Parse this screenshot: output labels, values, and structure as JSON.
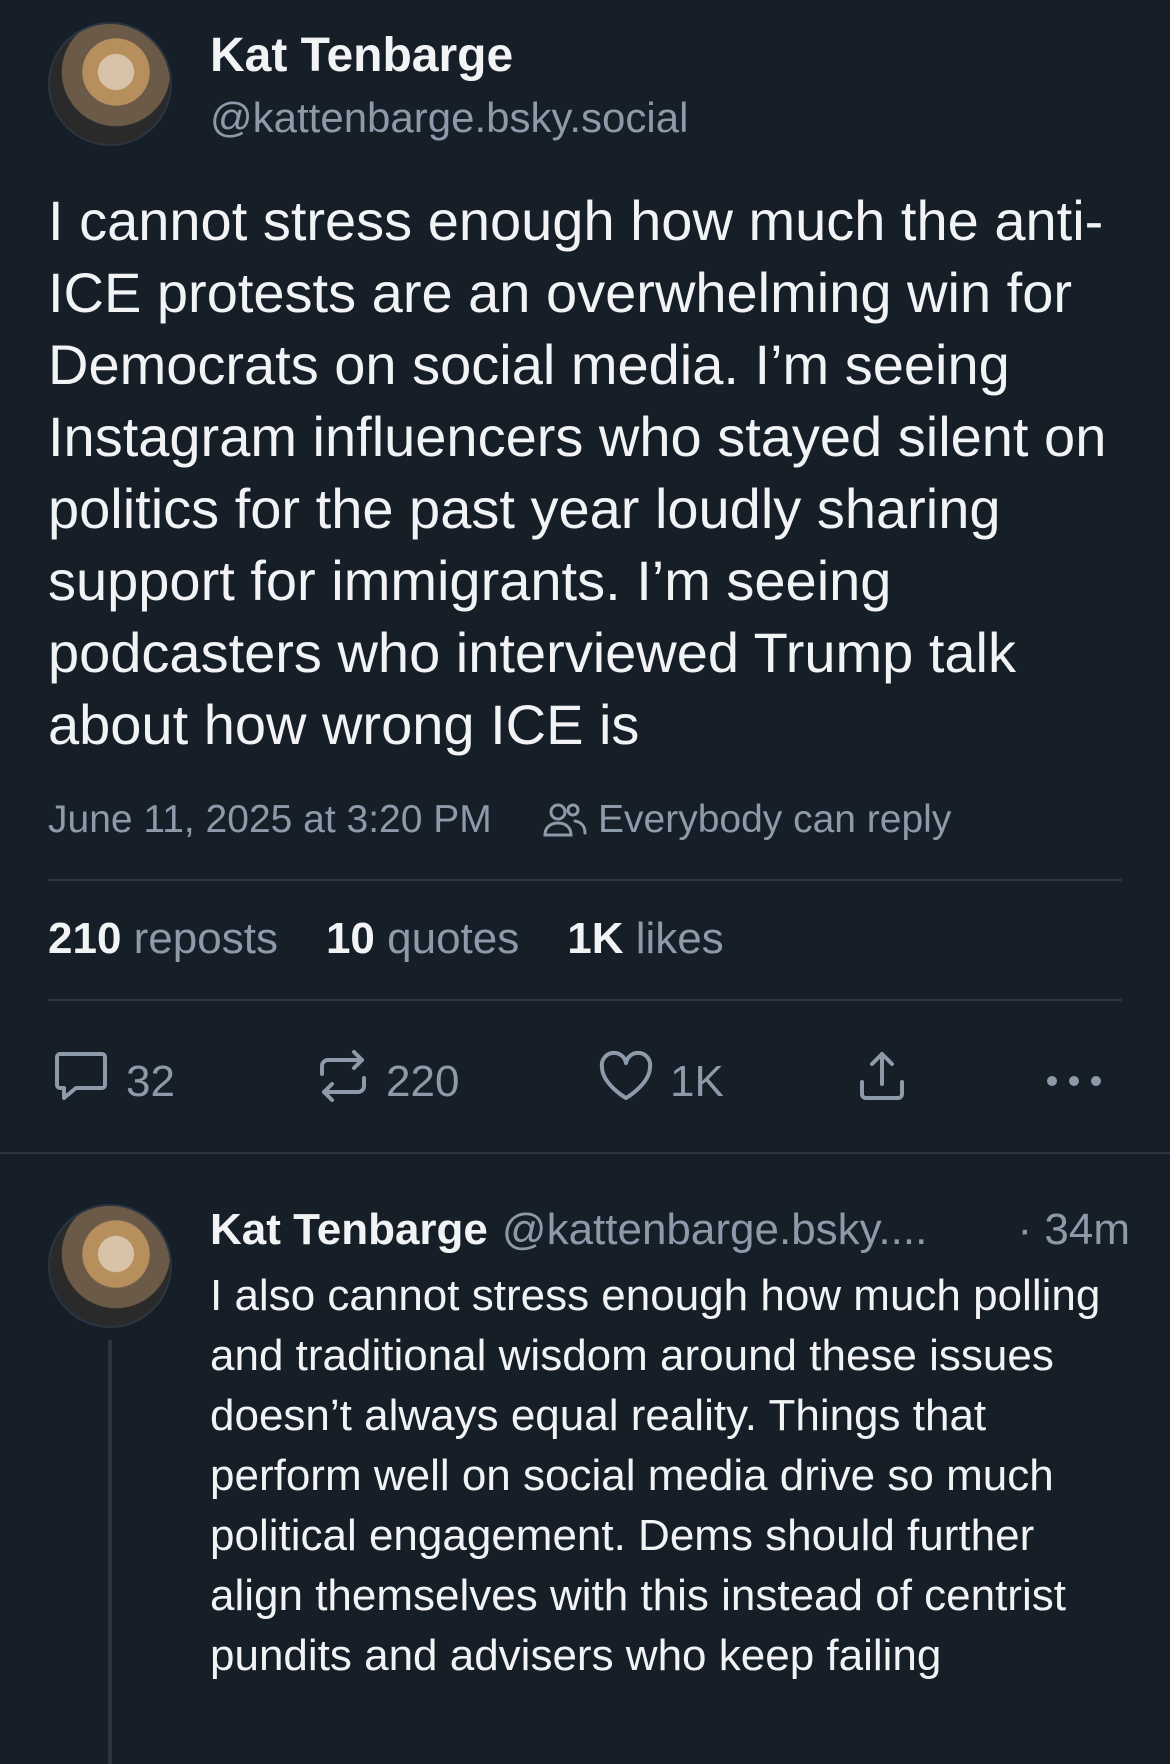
{
  "post": {
    "author_name": "Kat Tenbarge",
    "author_handle": "@kattenbarge.bsky.social",
    "text": "I cannot stress enough how much the anti-ICE protests are an overwhelming win for Democrats on social media. I’m seeing Instagram influencers who stayed silent on politics for the past year loudly sharing support for immigrants. I’m seeing podcasters who interviewed Trump talk about how wrong ICE is",
    "timestamp": "June 11, 2025 at 3:20 PM",
    "reply_setting": "Everybody can reply",
    "stats": {
      "reposts_count": "210",
      "reposts_label": "reposts",
      "quotes_count": "10",
      "quotes_label": "quotes",
      "likes_count": "1K",
      "likes_label": "likes"
    },
    "actions": {
      "reply_count": "32",
      "repost_count": "220",
      "like_count": "1K"
    }
  },
  "reply": {
    "author_name": "Kat Tenbarge",
    "author_handle": "@kattenbarge.bsky....",
    "time": "· 34m",
    "text": "I also cannot stress enough how much polling and traditional wisdom around these issues doesn’t always equal reality. Things that perform well on social media drive so much political engagement. Dems should further align themselves with this instead of centrist pundits and advisers who keep failing"
  },
  "icons": {
    "reply": "speech-bubble-icon",
    "repost": "repost-arrows-icon",
    "like": "heart-icon",
    "share": "share-icon",
    "more": "ellipsis-icon",
    "audience": "people-icon"
  }
}
